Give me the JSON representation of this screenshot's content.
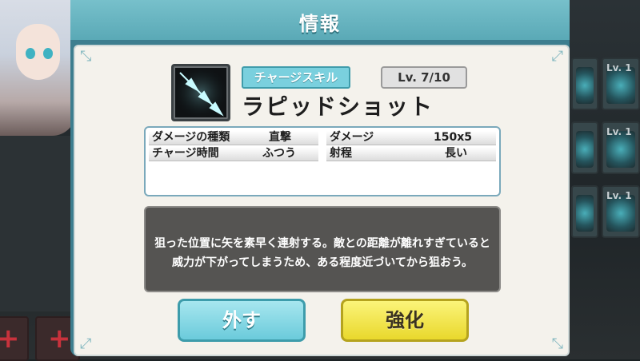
{
  "dialog": {
    "title": "情報"
  },
  "skill": {
    "icon": "triple-arrow-icon",
    "category": "チャージスキル",
    "level": "Lv. 7/10",
    "name": "ラピッドショット"
  },
  "stats": [
    {
      "label": "ダメージの種類",
      "value": "直撃"
    },
    {
      "label": "チャージ時間",
      "value": "ふつう"
    },
    {
      "label": "ダメージ",
      "value": "150x5"
    },
    {
      "label": "射程",
      "value": "長い"
    }
  ],
  "description": {
    "line1": "狙った位置に矢を素早く連射する。敵との距離が離れすぎていると",
    "line2": "威力が下がってしまうため、ある程度近づいてから狙おう。"
  },
  "buttons": {
    "remove": "外す",
    "upgrade": "強化"
  },
  "background": {
    "cell_levels": [
      "Lv. 1",
      "Lv. 1",
      "Lv. 1"
    ]
  },
  "colors": {
    "dialog_header": "#6bb6c1",
    "paper": "#f4f2ec",
    "remove_button": "#7ad0de",
    "upgrade_button": "#f0e23a"
  }
}
